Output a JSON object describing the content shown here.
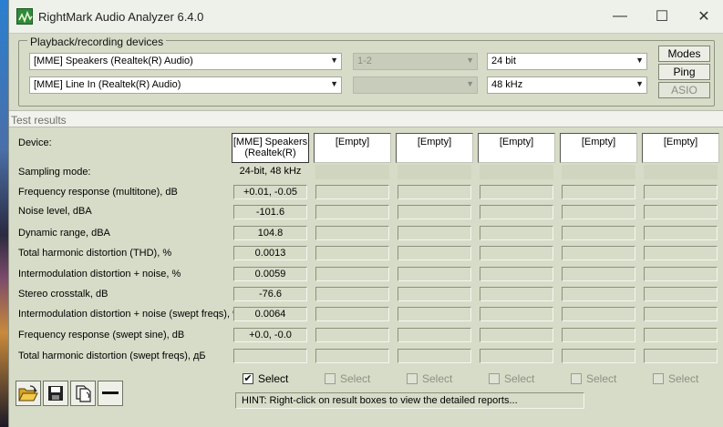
{
  "window": {
    "title": "RightMark Audio Analyzer 6.4.0",
    "controls": {
      "minimize": "—",
      "maximize": "☐",
      "close": "✕"
    }
  },
  "devices": {
    "legend": "Playback/recording devices",
    "playback_device": "[MME] Speakers (Realtek(R) Audio)",
    "recording_device": "[MME] Line In (Realtek(R) Audio)",
    "channels": "1-2",
    "channels_2": "",
    "bit_depth": "24 bit",
    "sample_rate": "48 kHz",
    "buttons": {
      "modes": "Modes",
      "ping": "Ping",
      "asio": "ASIO"
    }
  },
  "results": {
    "title": "Test results",
    "rows": {
      "device": "Device:",
      "sampling": "Sampling mode:",
      "freq_resp": "Frequency response (multitone), dB",
      "noise": "Noise level, dBA",
      "dyn_range": "Dynamic range, dBA",
      "thd": "Total harmonic distortion (THD), %",
      "imd": "Intermodulation distortion + noise, %",
      "crosstalk": "Stereo crosstalk, dB",
      "imd_swept": "Intermodulation distortion + noise (swept freqs), %",
      "freq_swept": "Frequency response (swept sine), dB",
      "thd_swept": "Total harmonic distortion (swept freqs), дБ"
    },
    "columns": [
      {
        "device": "[MME] Speakers\n(Realtek(R)",
        "sampling": "24-bit, 48 kHz",
        "freq_resp": "+0.01, -0.05",
        "noise": "-101.6",
        "dyn_range": "104.8",
        "thd": "0.0013",
        "imd": "0.0059",
        "crosstalk": "-76.6",
        "imd_swept": "0.0064",
        "freq_swept": "+0.0, -0.0",
        "thd_swept": "",
        "select_label": "Select",
        "selected": true
      },
      {
        "device": "[Empty]",
        "select_label": "Select",
        "selected": false
      },
      {
        "device": "[Empty]",
        "select_label": "Select",
        "selected": false
      },
      {
        "device": "[Empty]",
        "select_label": "Select",
        "selected": false
      },
      {
        "device": "[Empty]",
        "select_label": "Select",
        "selected": false
      },
      {
        "device": "[Empty]",
        "select_label": "Select",
        "selected": false
      }
    ],
    "check_mark": "✔",
    "hint": "HINT: Right-click on result boxes to view the detailed reports..."
  },
  "toolbar": {
    "icons": [
      "open-folder-icon",
      "save-disk-icon",
      "copy-documents-icon",
      "minus-icon"
    ]
  }
}
